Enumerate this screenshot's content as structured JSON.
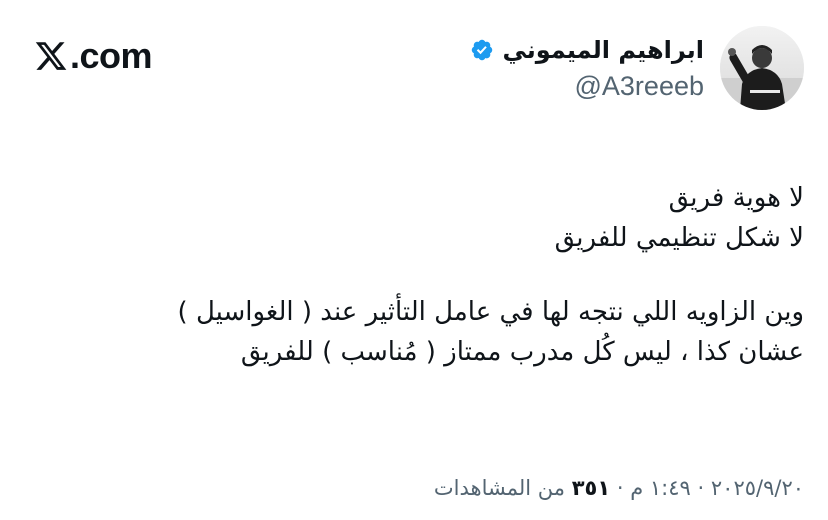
{
  "brand": {
    "logo_text": ".com"
  },
  "author": {
    "display_name": "ابراهيم الميموني",
    "handle": "@A3reeeb",
    "verified": true,
    "verified_color": "#1d9bf0"
  },
  "tweet": {
    "lines": [
      "لا هوية فريق",
      "لا شكل تنظيمي للفريق",
      "",
      "وين الزاويه اللي نتجه لها في عامل التأثير عند ( الغواسيل )",
      "عشان كذا ، ليس كُل مدرب ممتاز ( مُناسب ) للفريق"
    ]
  },
  "meta": {
    "date": "٢٠٢٥/٩/٢٠",
    "separator": "·",
    "time": "١:٤٩ م",
    "views_count": "٣٥١",
    "views_label": "من المشاهدات"
  },
  "colors": {
    "text_primary": "#0f1419",
    "text_secondary": "#536471",
    "background": "#ffffff"
  },
  "icons": {
    "logo": "x-logo-icon",
    "verified": "verified-badge-icon",
    "avatar": "profile-avatar"
  }
}
